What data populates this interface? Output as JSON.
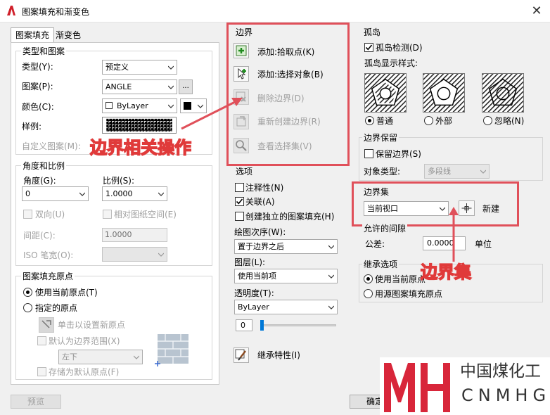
{
  "dialog": {
    "title": "图案填充和渐变色",
    "close_glyph": "✕"
  },
  "tabs": [
    "图案填充",
    "渐变色"
  ],
  "type_pattern": {
    "group_title": "类型和图案",
    "type_label": "类型(Y):",
    "type_value": "预定义",
    "pattern_label": "图案(P):",
    "pattern_value": "ANGLE",
    "pattern_browse": "...",
    "color_label": "颜色(C):",
    "color_value": "ByLayer",
    "sample_label": "样例:",
    "custom_label": "自定义图案(M):"
  },
  "angle_scale": {
    "group_title": "角度和比例",
    "angle_label": "角度(G):",
    "angle_value": "0",
    "scale_label": "比例(S):",
    "scale_value": "1.0000",
    "double_label": "双向(U)",
    "relative_label": "相对图纸空间(E)",
    "spacing_label": "间距(C):",
    "spacing_value": "1.0000",
    "iso_label": "ISO 笔宽(O):"
  },
  "origin": {
    "group_title": "图案填充原点",
    "use_current_label": "使用当前原点(T)",
    "specified_label": "指定的原点",
    "click_set_label": "单击以设置新原点",
    "default_extent_label": "默认为边界范围(X)",
    "extent_value": "左下",
    "store_default_label": "存储为默认原点(F)"
  },
  "boundaries": {
    "group_title": "边界",
    "add_pick_label": "添加:拾取点(K)",
    "add_select_label": "添加:选择对象(B)",
    "remove_label": "删除边界(D)",
    "recreate_label": "重新创建边界(R)",
    "view_selection_label": "查看选择集(V)"
  },
  "options": {
    "group_title": "选项",
    "annotative_label": "注释性(N)",
    "associative_label": "关联(A)",
    "independent_label": "创建独立的图案填充(H)",
    "draw_order_label": "绘图次序(W):",
    "draw_order_value": "置于边界之后",
    "layer_label": "图层(L):",
    "layer_value": "使用当前项",
    "transparency_label": "透明度(T):",
    "transparency_value": "ByLayer",
    "transparency_amount": "0"
  },
  "inherit_label": "继承特性(I)",
  "islands": {
    "group_title": "孤岛",
    "detect_label": "孤岛检测(D)",
    "style_label": "孤岛显示样式:",
    "normal_label": "普通",
    "outer_label": "外部",
    "ignore_label": "忽略(N)"
  },
  "boundary_retention": {
    "group_title": "边界保留",
    "retain_label": "保留边界(S)",
    "object_type_label": "对象类型:",
    "object_type_value": "多段线"
  },
  "boundary_set": {
    "group_title": "边界集",
    "value": "当前视口",
    "new_label": "新建"
  },
  "gap_tolerance": {
    "group_title": "允许的间隙",
    "tolerance_label": "公差:",
    "tolerance_value": "0.0000",
    "unit_label": "单位"
  },
  "inherit_options": {
    "group_title": "继承选项",
    "use_current_label": "使用当前原点",
    "use_source_label": "用源图案填充原点"
  },
  "footer": {
    "preview_label": "预览",
    "ok_label": "确定"
  },
  "annotations": {
    "boundary_ops": "边界相关操作",
    "boundary_set": "边界集",
    "accent_color": "#e0505a"
  },
  "watermark": {
    "logo_text": "MH",
    "cn": "中国煤化工",
    "en": "CNMHG"
  }
}
